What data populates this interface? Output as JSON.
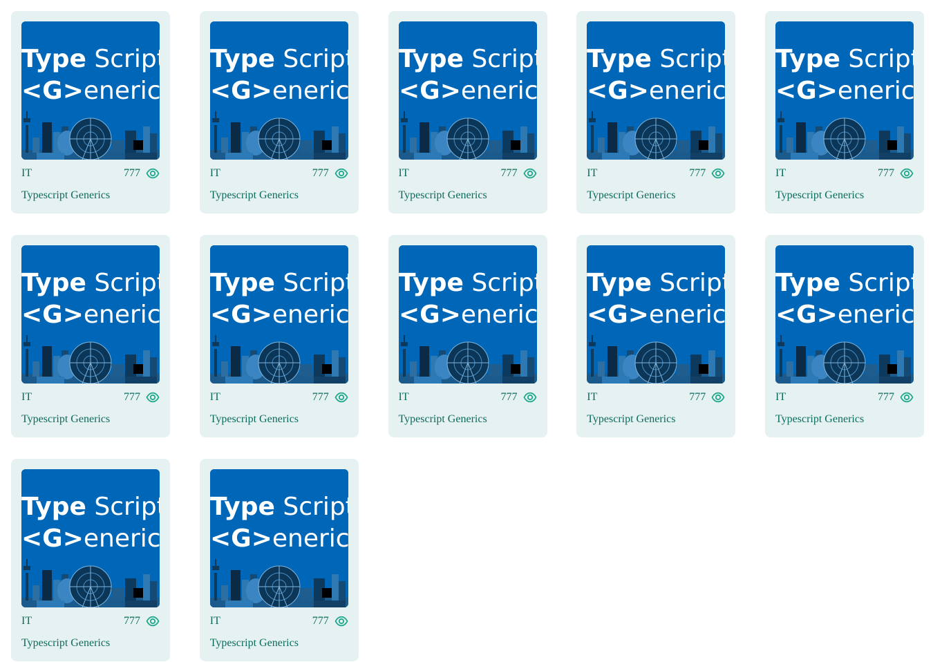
{
  "colors": {
    "card_background": "#e6f2f2",
    "text": "#0b6b5d",
    "thumbnail_background": "#0066b8"
  },
  "cards": [
    {
      "category": "IT",
      "views": "777",
      "title": "Typescript Generics",
      "thumbnail": {
        "line1a": "Type",
        "line1b": " Script",
        "line2a": "<G>",
        "line2b": "enerics"
      },
      "icon": "eye-icon"
    },
    {
      "category": "IT",
      "views": "777",
      "title": "Typescript Generics",
      "thumbnail": {
        "line1a": "Type",
        "line1b": " Script",
        "line2a": "<G>",
        "line2b": "enerics"
      },
      "icon": "eye-icon"
    },
    {
      "category": "IT",
      "views": "777",
      "title": "Typescript Generics",
      "thumbnail": {
        "line1a": "Type",
        "line1b": " Script",
        "line2a": "<G>",
        "line2b": "enerics"
      },
      "icon": "eye-icon"
    },
    {
      "category": "IT",
      "views": "777",
      "title": "Typescript Generics",
      "thumbnail": {
        "line1a": "Type",
        "line1b": " Script",
        "line2a": "<G>",
        "line2b": "enerics"
      },
      "icon": "eye-icon"
    },
    {
      "category": "IT",
      "views": "777",
      "title": "Typescript Generics",
      "thumbnail": {
        "line1a": "Type",
        "line1b": " Script",
        "line2a": "<G>",
        "line2b": "enerics"
      },
      "icon": "eye-icon"
    },
    {
      "category": "IT",
      "views": "777",
      "title": "Typescript Generics",
      "thumbnail": {
        "line1a": "Type",
        "line1b": " Script",
        "line2a": "<G>",
        "line2b": "enerics"
      },
      "icon": "eye-icon"
    },
    {
      "category": "IT",
      "views": "777",
      "title": "Typescript Generics",
      "thumbnail": {
        "line1a": "Type",
        "line1b": " Script",
        "line2a": "<G>",
        "line2b": "enerics"
      },
      "icon": "eye-icon"
    },
    {
      "category": "IT",
      "views": "777",
      "title": "Typescript Generics",
      "thumbnail": {
        "line1a": "Type",
        "line1b": " Script",
        "line2a": "<G>",
        "line2b": "enerics"
      },
      "icon": "eye-icon"
    },
    {
      "category": "IT",
      "views": "777",
      "title": "Typescript Generics",
      "thumbnail": {
        "line1a": "Type",
        "line1b": " Script",
        "line2a": "<G>",
        "line2b": "enerics"
      },
      "icon": "eye-icon"
    },
    {
      "category": "IT",
      "views": "777",
      "title": "Typescript Generics",
      "thumbnail": {
        "line1a": "Type",
        "line1b": " Script",
        "line2a": "<G>",
        "line2b": "enerics"
      },
      "icon": "eye-icon"
    },
    {
      "category": "IT",
      "views": "777",
      "title": "Typescript Generics",
      "thumbnail": {
        "line1a": "Type",
        "line1b": " Script",
        "line2a": "<G>",
        "line2b": "enerics"
      },
      "icon": "eye-icon"
    },
    {
      "category": "IT",
      "views": "777",
      "title": "Typescript Generics",
      "thumbnail": {
        "line1a": "Type",
        "line1b": " Script",
        "line2a": "<G>",
        "line2b": "enerics"
      },
      "icon": "eye-icon"
    }
  ]
}
